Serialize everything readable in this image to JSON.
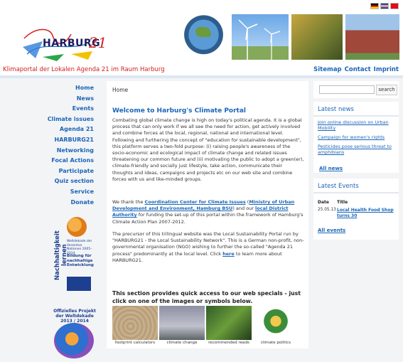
{
  "header": {
    "languages": [
      "de",
      "en",
      "tr"
    ],
    "logo_text": "HARBURG",
    "logo_number": "21",
    "tagline": "Klimaportal der Lokalen Agenda 21 im Raum Harburg",
    "topnav": [
      "Sitemap",
      "Contact",
      "Imprint"
    ]
  },
  "leftnav": {
    "items": [
      "Home",
      "News",
      "Events",
      "Climate issues",
      "Agenda 21",
      "HARBURG21",
      "Networking",
      "Focal Actions",
      "Participate",
      "Quiz section",
      "Service",
      "Donate"
    ]
  },
  "badge": {
    "vertical_text": "Nachhaltigkeit lernen",
    "small_text": "Weltdekade der Vereinten Nationen 2005–2014",
    "bildung": "Bildung für nachhaltige Entwicklung",
    "caption": "Offizielles Projekt der Weltdekade 2013 / 2014"
  },
  "main": {
    "breadcrumb": "Home",
    "title": "Welcome to Harburg's Climate Portal",
    "p1": "Combating global climate change is high on today's political agenda. It is a global process that can only work if we all see the need for action, get actively involved and combine forces at the local, regional, national and international level. Following and furthering the concept of \"education for sustainable development\", this platform serves a two-fold purpose: (i) raising people's awareness of the socio-economic and ecological impact of climate change and related issues threatening our common future and (ii) motivating the public to adopt a green(er), climate-friendly and socially just lifestyle, take action, communicate their thoughts and ideas, campaigns and projects etc on our web site and combine forces with us and like-minded groups.",
    "p2_a": "We thank the ",
    "p2_link1": "Coordination Center for Climate Issues",
    "p2_b": " (",
    "p2_link2": "Ministry of Urban Development and Environment, Hamburg BSU",
    "p2_c": ") and our ",
    "p2_link3": "local District Authority",
    "p2_d": " for funding the set-up of this portal within the framework of Hamburg's Climate Action Plan 2007-2012.",
    "p3_a": "The precursor of this trilingual website was the Local Sustainability Portal run by \"HARBURG21 - the Local Sustainability Network\". This is a German non-profit, non-governmental organisation (NGO) wishing to further the so-called \"Agenda 21 process\" predominantly at the local level. Click ",
    "p3_link": "here",
    "p3_b": " to learn more about HARBURG21."
  },
  "specials": {
    "title": "This section provides quick access to our web specials - just click on one of the images or symbols below.",
    "items": [
      "footprint calculators",
      "climate change",
      "recommended reads",
      "climate politics"
    ]
  },
  "search": {
    "placeholder": "",
    "button": "search"
  },
  "news": {
    "title": "Latest news",
    "items": [
      "Join online discussion on Urban Mobility",
      "Campaign for women's rights",
      "Pesticides pose serious threat to amphibians"
    ],
    "all": "All news"
  },
  "events": {
    "title": "Latest Events",
    "col_date": "Date",
    "col_title": "Title",
    "date": "25.05.13",
    "event_title": "Local Health Food Shop turns 30",
    "all": "All events"
  }
}
